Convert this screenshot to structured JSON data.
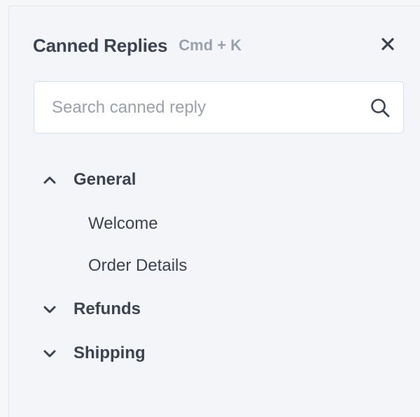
{
  "header": {
    "title": "Canned Replies",
    "shortcut": "Cmd + K",
    "close_icon": "close-icon"
  },
  "search": {
    "placeholder": "Search canned reply",
    "value": "",
    "icon": "search-icon"
  },
  "categories": [
    {
      "label": "General",
      "expanded": true,
      "icon": "chevron-up-icon",
      "items": [
        {
          "label": "Welcome"
        },
        {
          "label": "Order Details"
        }
      ]
    },
    {
      "label": "Refunds",
      "expanded": false,
      "icon": "chevron-down-icon",
      "items": []
    },
    {
      "label": "Shipping",
      "expanded": false,
      "icon": "chevron-down-icon",
      "items": []
    }
  ],
  "colors": {
    "text": "#3b4252",
    "muted": "#9aa1ad",
    "background": "#f4f5f8",
    "search_border": "#cfe0f5"
  }
}
